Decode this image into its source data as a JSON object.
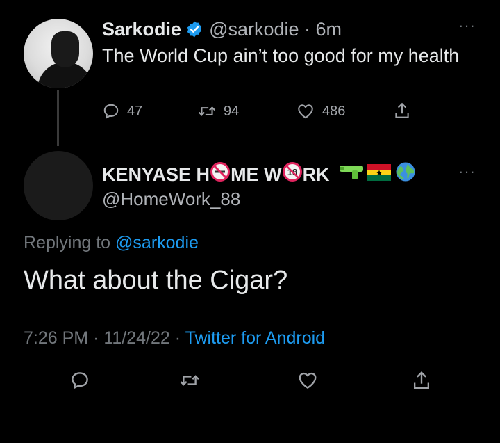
{
  "tweet": {
    "author_name": "Sarkodie",
    "author_handle": "@sarkodie",
    "time": "6m",
    "text": "The World Cup ain’t too good for my health",
    "replies": "47",
    "retweets": "94",
    "likes": "486"
  },
  "reply": {
    "name_part1": "KENYASE H",
    "name_part2": "ME W",
    "name_part3": "RK",
    "author_handle": "@HomeWork_88",
    "replying_prefix": "Replying to",
    "replying_handle": "@sarkodie",
    "text": "What about the Cigar?",
    "time": "7:26 PM",
    "date": "11/24/22",
    "source": "Twitter for Android"
  },
  "icons": [
    "verified-icon",
    "more-icon",
    "reply-icon",
    "retweet-icon",
    "like-icon",
    "share-icon",
    "no-smoking-icon",
    "no-under-18-icon",
    "water-pistol-icon",
    "ghana-flag-icon",
    "globe-icon"
  ],
  "colors": {
    "background": "#000000",
    "text": "#e7e9ea",
    "muted": "#71767b",
    "link": "#1d9bf0",
    "verified": "#1d9bf0"
  }
}
